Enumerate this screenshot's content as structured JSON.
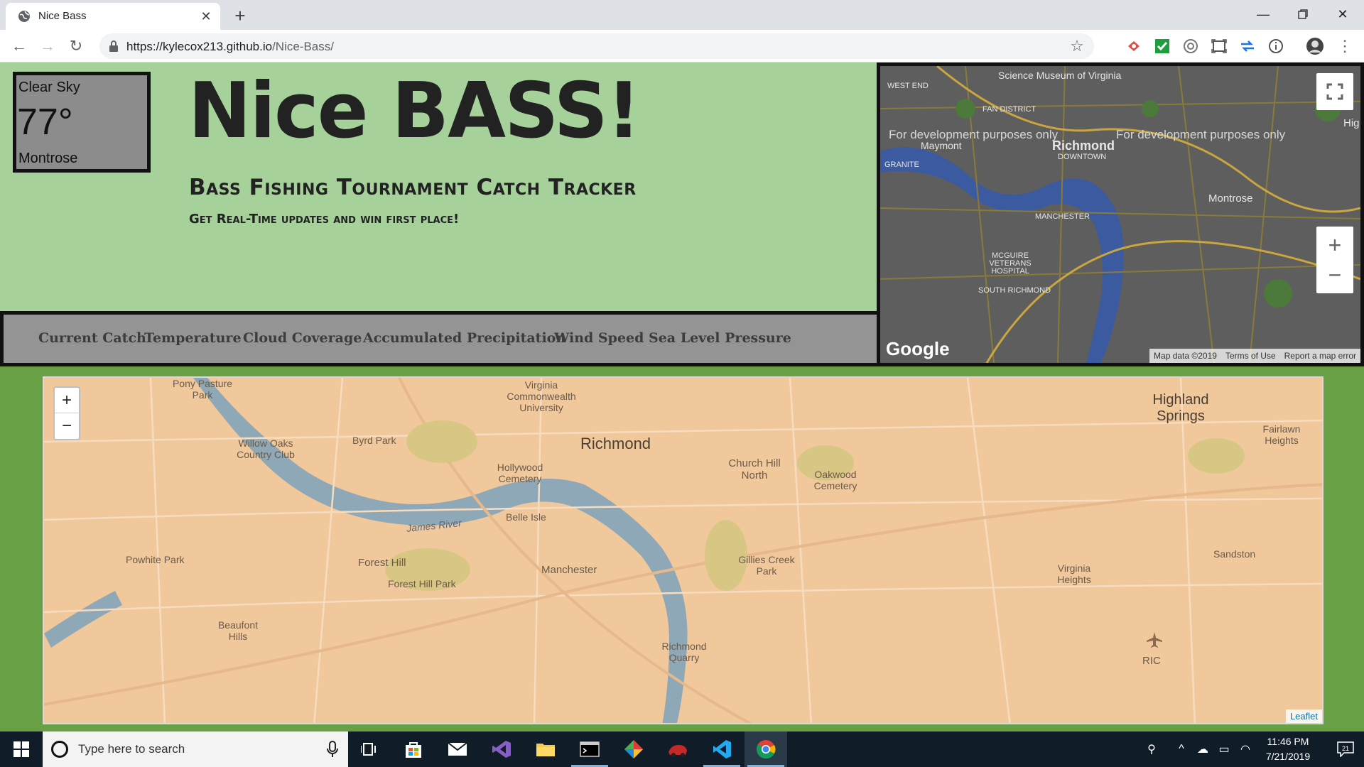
{
  "browser": {
    "tab_title": "Nice Bass",
    "url_host": "https://kylecox213.github.io",
    "url_path": "/Nice-Bass/"
  },
  "weather": {
    "condition": "Clear Sky",
    "temperature": "77°",
    "location": "Montrose"
  },
  "header": {
    "title": "Nice BASS!",
    "subtitle": "Bass Fishing Tournament Catch Tracker",
    "tagline": "Get Real-Time updates and win first place!"
  },
  "nav": {
    "items": [
      "Current Catch",
      "Temperature",
      "Cloud Coverage",
      "Accumulated Precipitation",
      "Wind Speed",
      "Sea Level Pressure"
    ]
  },
  "google_map": {
    "labels": {
      "museum": "Science Museum of Virginia",
      "west_end": "WEST END",
      "fan_district": "FAN DISTRICT",
      "dev1": "For development purposes only",
      "dev2": "For development purposes only",
      "maymont": "Maymont",
      "richmond": "Richmond",
      "downtown": "DOWNTOWN",
      "granite": "GRANITE",
      "montrose": "Montrose",
      "manchester": "MANCHESTER",
      "mcguire": "MCGUIRE VETERANS HOSPITAL",
      "south_richmond": "SOUTH RICHMOND",
      "hig": "Hig"
    },
    "footer": {
      "map_data": "Map data ©2019",
      "terms": "Terms of Use",
      "report": "Report a map error"
    },
    "logo": "Google"
  },
  "leaflet_map": {
    "labels": {
      "richmond": "Richmond",
      "pony_pasture": "Pony Pasture Park",
      "vcu": "Virginia Commonwealth University",
      "byrd_park": "Byrd Park",
      "hollywood": "Hollywood Cemetery",
      "willow_oaks": "Willow Oaks Country Club",
      "church_hill": "Church Hill North",
      "oakwood": "Oakwood Cemetery",
      "highland_springs": "Highland Springs",
      "fairlawn": "Fairlawn Heights",
      "james_river": "James River",
      "belle_isle": "Belle Isle",
      "forest_hill": "Forest Hill",
      "forest_hill_park": "Forest Hill Park",
      "manchester": "Manchester",
      "gillies": "Gillies Creek Park",
      "powhite": "Powhite Park",
      "beaufont": "Beaufont Hills",
      "virginia_heights": "Virginia Heights",
      "sandston": "Sandston",
      "richmond_quarry": "Richmond Quarry",
      "ric": "RIC"
    },
    "attribution": "Leaflet"
  },
  "taskbar": {
    "search_placeholder": "Type here to search",
    "time": "11:46 PM",
    "date": "7/21/2019",
    "notifications": "21"
  }
}
